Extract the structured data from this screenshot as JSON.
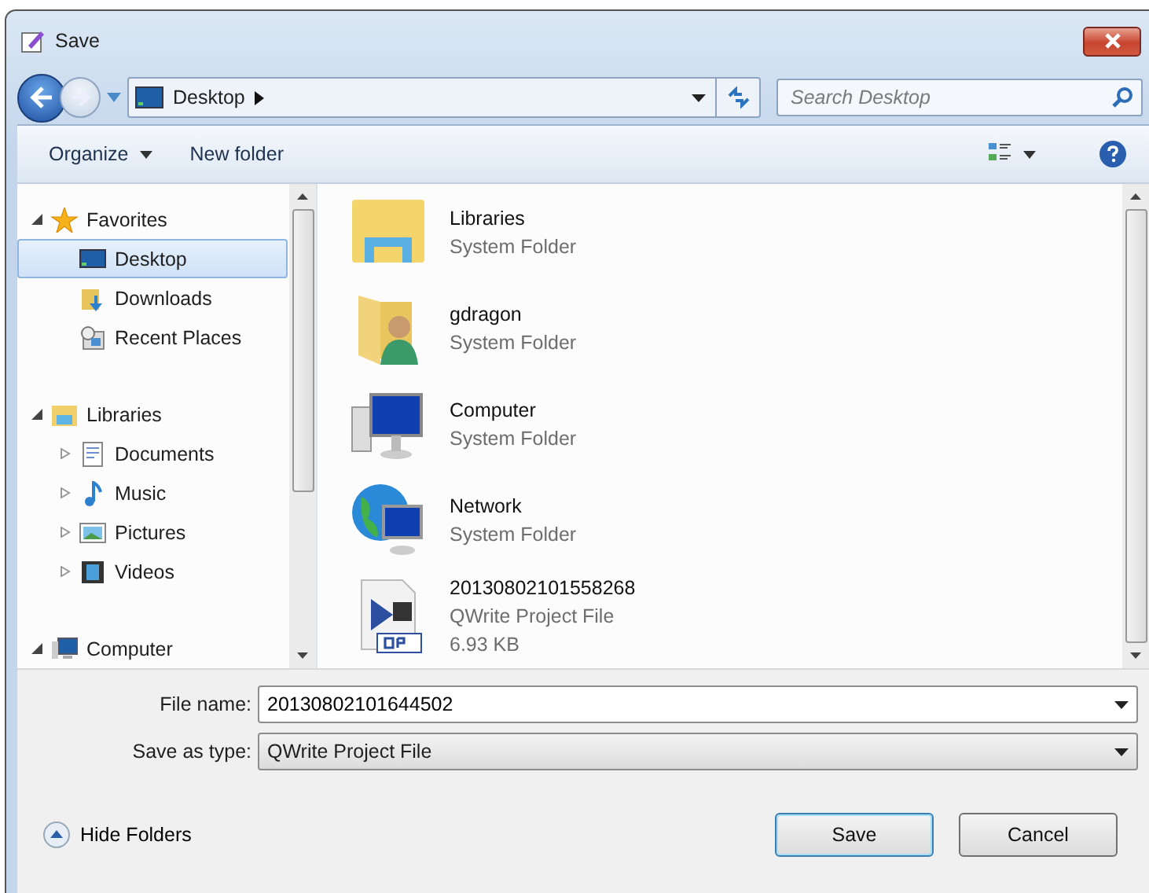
{
  "window": {
    "title": "Save"
  },
  "address": {
    "location": "Desktop"
  },
  "search": {
    "placeholder": "Search Desktop"
  },
  "toolbar": [
    {
      "label": "Organize",
      "kind": "menu"
    },
    {
      "label": "New folder",
      "kind": "button"
    }
  ],
  "navigation": [
    {
      "label": "Favorites",
      "expanded": true,
      "selected": false,
      "children": [
        {
          "label": "Desktop",
          "selected": true
        },
        {
          "label": "Downloads",
          "selected": false
        },
        {
          "label": "Recent Places",
          "selected": false
        }
      ]
    },
    {
      "label": "Libraries",
      "expanded": true,
      "selected": false,
      "children": [
        {
          "label": "Documents",
          "expanded": false,
          "selected": false
        },
        {
          "label": "Music",
          "expanded": false,
          "selected": false
        },
        {
          "label": "Pictures",
          "expanded": false,
          "selected": false
        },
        {
          "label": "Videos",
          "expanded": false,
          "selected": false
        }
      ]
    },
    {
      "label": "Computer",
      "expanded": true,
      "selected": false
    }
  ],
  "files": [
    {
      "name": "Libraries",
      "type": "System Folder"
    },
    {
      "name": "gdragon",
      "type": "System Folder"
    },
    {
      "name": "Computer",
      "type": "System Folder"
    },
    {
      "name": "Network",
      "type": "System Folder"
    },
    {
      "name": "20130802101558268",
      "type": "QWrite Project File",
      "size": "6.93 KB"
    }
  ],
  "file_name": {
    "label": "File name:",
    "value": "20130802101644502"
  },
  "save_as_type": {
    "label": "Save as type:",
    "value": "QWrite Project File"
  },
  "hide_folders": "Hide Folders",
  "buttons": [
    {
      "label": "Save",
      "default": true
    },
    {
      "label": "Cancel",
      "default": false
    }
  ]
}
